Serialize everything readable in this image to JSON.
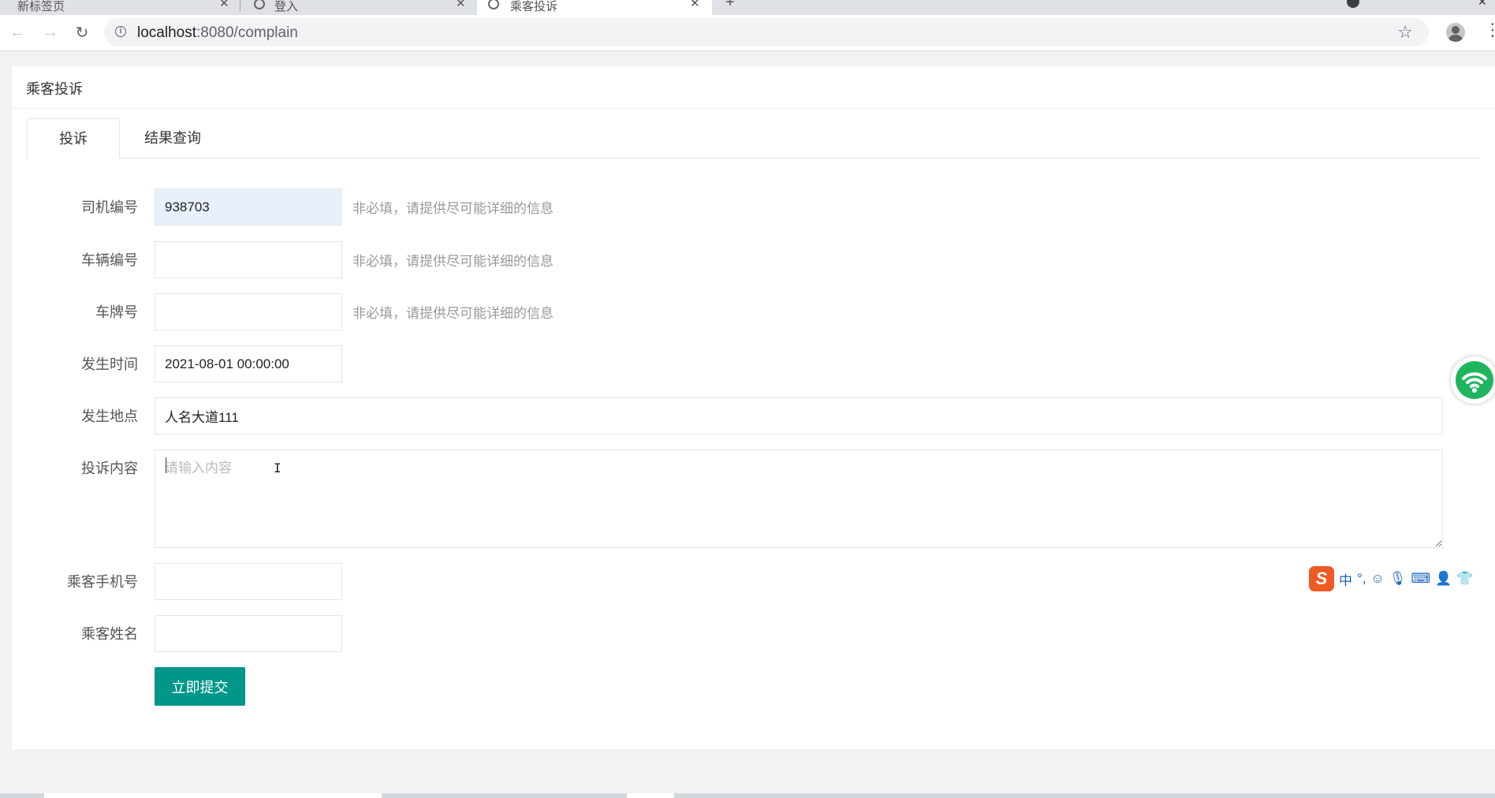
{
  "browser": {
    "tabs": [
      {
        "label": "新标签页",
        "active": false
      },
      {
        "label": "登入",
        "active": false
      },
      {
        "label": "乘客投诉",
        "active": true
      }
    ],
    "new_tab_label": "+",
    "url_host": "localhost",
    "url_rest": ":8080/complain"
  },
  "page": {
    "title": "乘客投诉",
    "tabs": [
      {
        "label": "投诉",
        "active": true
      },
      {
        "label": "结果查询",
        "active": false
      }
    ]
  },
  "form": {
    "driver_no": {
      "label": "司机编号",
      "value": "938703",
      "hint": "非必填，请提供尽可能详细的信息"
    },
    "vehicle_no": {
      "label": "车辆编号",
      "value": "",
      "hint": "非必填，请提供尽可能详细的信息"
    },
    "plate_no": {
      "label": "车牌号",
      "value": "",
      "hint": "非必填，请提供尽可能详细的信息"
    },
    "time": {
      "label": "发生时间",
      "value": "2021-08-01 00:00:00"
    },
    "location": {
      "label": "发生地点",
      "value": "人名大道111"
    },
    "content": {
      "label": "投诉内容",
      "value": "",
      "placeholder": "请输入内容"
    },
    "phone": {
      "label": "乘客手机号",
      "value": ""
    },
    "name": {
      "label": "乘客姓名",
      "value": ""
    },
    "submit_label": "立即提交"
  },
  "ime": {
    "mode": "中",
    "punct": "°,"
  },
  "colors": {
    "accent": "#009688",
    "autofill": "#e8f0fe"
  }
}
